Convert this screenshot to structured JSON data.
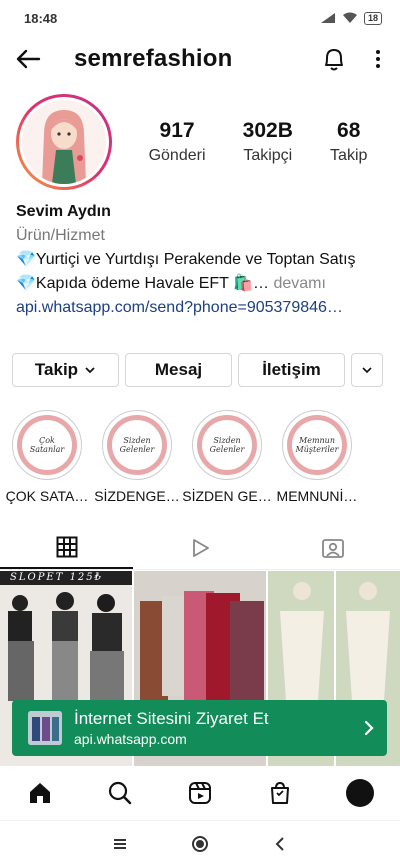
{
  "status_bar": {
    "time": "18:48",
    "battery": "18"
  },
  "header": {
    "username": "semrefashion"
  },
  "stats": [
    {
      "value": "917",
      "label": "Gönderi"
    },
    {
      "value": "302B",
      "label": "Takipçi"
    },
    {
      "value": "68",
      "label": "Takip"
    }
  ],
  "bio": {
    "name": "Sevim Aydın",
    "category": "Ürün/Hizmet",
    "line1": "💎Yurtiçi ve Yurtdışı Perakende ve Toptan Satış",
    "line2": "💎Kapıda ödeme Havale EFT 🛍️… ",
    "more": "devamı",
    "link": "api.whatsapp.com/send?phone=905379846…"
  },
  "buttons": {
    "follow": "Takip",
    "message": "Mesaj",
    "contact": "İletişim"
  },
  "highlights": [
    {
      "cover": "Çok Satanlar",
      "label": "ÇOK SATA…"
    },
    {
      "cover": "Sizden Gelenler",
      "label": "SİZDENGE…"
    },
    {
      "cover": "Sizden Gelenler",
      "label": "SİZDEN GE…"
    },
    {
      "cover": "Memnun Müşteriler",
      "label": "MEMNUNİ…"
    }
  ],
  "grid": {
    "post1_caption": "SLOPET 125₺"
  },
  "banner": {
    "title": "İnternet Sitesini Ziyaret Et",
    "url": "api.whatsapp.com"
  },
  "colors": {
    "banner": "#128c58",
    "link": "#1c3f80",
    "highlight_ring": "#e8a8aa"
  }
}
